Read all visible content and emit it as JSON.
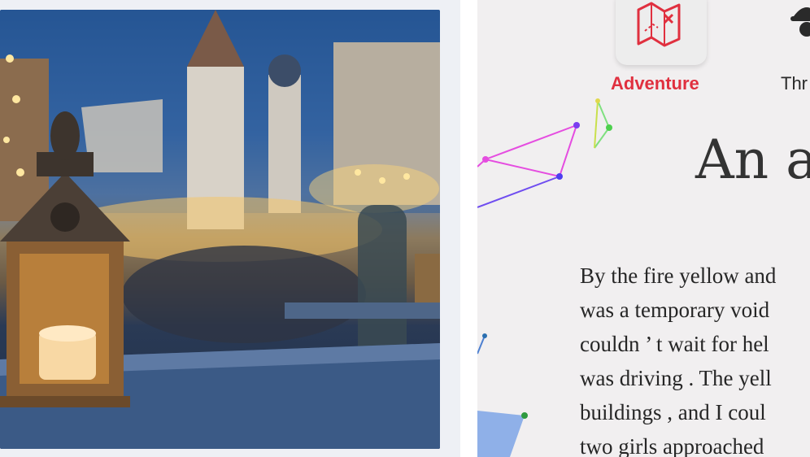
{
  "genres": [
    {
      "label": "Adventure",
      "icon": "treasure-map-icon",
      "color": "#e0303f",
      "selected": true
    },
    {
      "label": "Thr",
      "icon": "spy-hat-icon",
      "color": "#2a2a2a",
      "selected": false
    }
  ],
  "story": {
    "title": "An ad",
    "lines": [
      "By the fire yellow and",
      "was a temporary void",
      "couldn ’ t wait for hel",
      "was driving . The yell",
      "buildings , and I coul",
      "two girls approached"
    ]
  },
  "photo": {
    "subject": "christmas-market-lantern-image"
  }
}
